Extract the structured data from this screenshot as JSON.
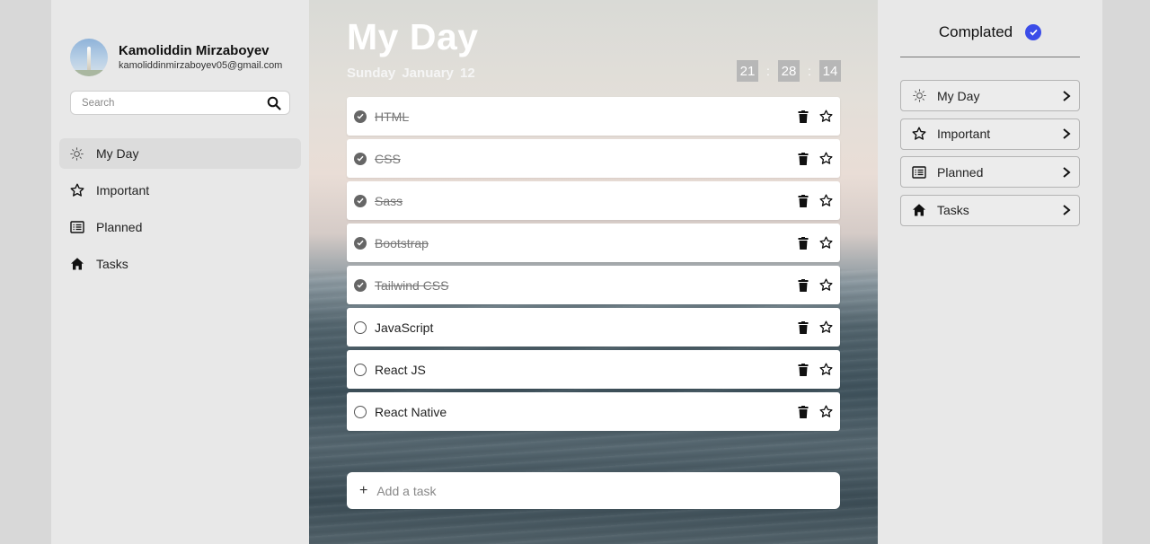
{
  "profile": {
    "name": "Kamoliddin Mirzaboyev",
    "email": "kamoliddinmirzaboyev05@gmail.com"
  },
  "search": {
    "placeholder": "Search",
    "icon": "search-icon"
  },
  "sidebar": {
    "items": [
      {
        "label": "My Day",
        "icon": "sun-icon",
        "active": true
      },
      {
        "label": "Important",
        "icon": "star-icon",
        "active": false
      },
      {
        "label": "Planned",
        "icon": "list-icon",
        "active": false
      },
      {
        "label": "Tasks",
        "icon": "home-icon",
        "active": false
      }
    ]
  },
  "main": {
    "title": "My Day",
    "date": "Sunday  January  12",
    "clock": {
      "hours": "21",
      "minutes": "28",
      "seconds": "14",
      "separator": ":"
    },
    "tasks": [
      {
        "title": "HTML",
        "done": true
      },
      {
        "title": "CSS",
        "done": true
      },
      {
        "title": "Sass",
        "done": true
      },
      {
        "title": "Bootstrap",
        "done": true
      },
      {
        "title": "Tailwind CSS",
        "done": true
      },
      {
        "title": "JavaScript",
        "done": false
      },
      {
        "title": "React JS",
        "done": false
      },
      {
        "title": "React Native",
        "done": false
      }
    ],
    "add_task": {
      "plus": "+",
      "placeholder": "Add a task"
    }
  },
  "right_panel": {
    "title": "Complated",
    "badge_color": "#3b4ce8",
    "items": [
      {
        "label": "My Day",
        "icon": "sun-icon"
      },
      {
        "label": "Important",
        "icon": "star-icon"
      },
      {
        "label": "Planned",
        "icon": "list-icon"
      },
      {
        "label": "Tasks",
        "icon": "home-icon"
      }
    ]
  }
}
